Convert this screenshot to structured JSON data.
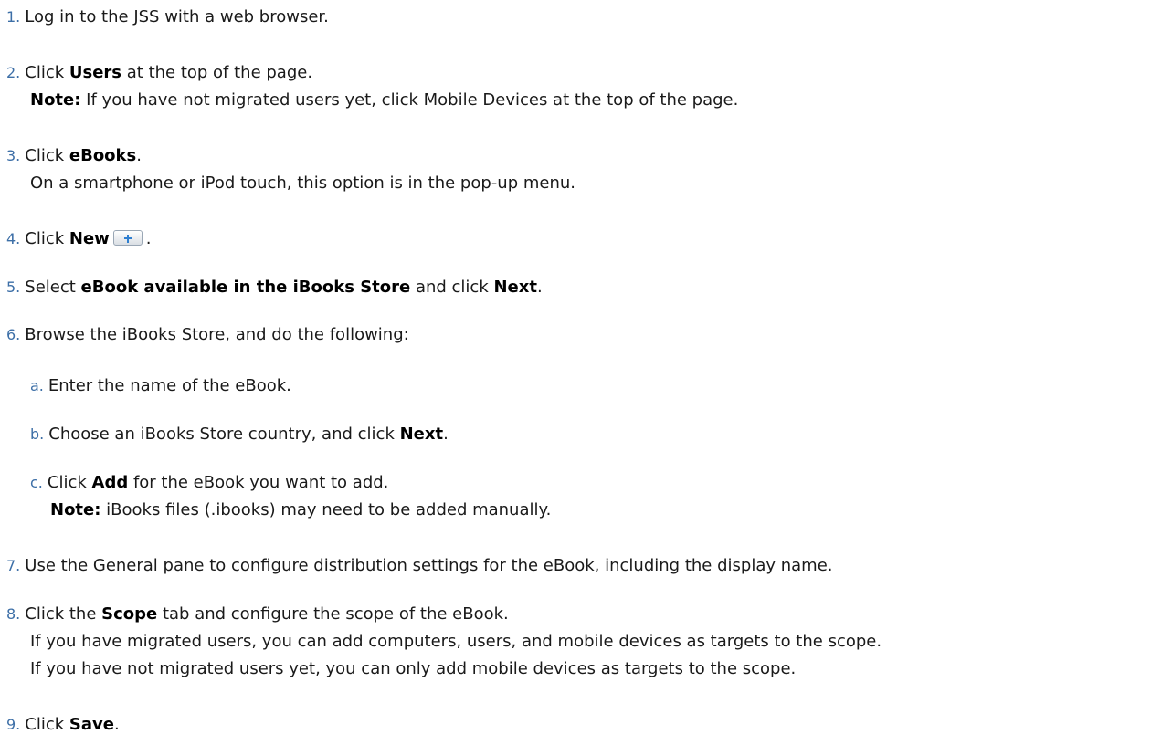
{
  "steps": [
    {
      "num": "1.",
      "text": "Log in to the JSS with a web browser."
    },
    {
      "num": "2.",
      "pre": "Click ",
      "bold": "Users",
      "post": " at the top of the page.",
      "note_label": "Note:",
      "note_text": " If you have not migrated users yet, click Mobile Devices at the top of the page."
    },
    {
      "num": "3.",
      "pre": "Click ",
      "bold": "eBooks",
      "post": ".",
      "line2": "On a smartphone or iPod touch, this option is in the pop-up menu."
    },
    {
      "num": "4.",
      "pre": "Click ",
      "bold": "New",
      "post": "."
    },
    {
      "num": "5.",
      "pre": "Select ",
      "bold": "eBook available in the iBooks Store",
      "mid": " and click ",
      "bold2": "Next",
      "post": "."
    },
    {
      "num": "6.",
      "text": "Browse the iBooks Store, and do the following:",
      "substeps": [
        {
          "num": "a.",
          "text": "Enter the name of the eBook."
        },
        {
          "num": "b.",
          "pre": "Choose an iBooks Store country, and click ",
          "bold": "Next",
          "post": "."
        },
        {
          "num": "c.",
          "pre": "Click ",
          "bold": "Add",
          "post": " for the eBook you want to add.",
          "note_label": "Note:",
          "note_text": " iBooks files (.ibooks) may need to be added manually."
        }
      ]
    },
    {
      "num": "7.",
      "text": "Use the General pane to configure distribution settings for the eBook, including the display name."
    },
    {
      "num": "8.",
      "pre": "Click the ",
      "bold": "Scope",
      "post": " tab and configure the scope of the eBook.",
      "line2": "If you have migrated users, you can add computers, users, and mobile devices as targets to the scope.",
      "line3": "If you have not migrated users yet, you can only add mobile devices as targets to the scope."
    },
    {
      "num": "9.",
      "pre": "Click ",
      "bold": "Save",
      "post": "."
    }
  ],
  "icons": {
    "new_button": "plus-icon"
  }
}
